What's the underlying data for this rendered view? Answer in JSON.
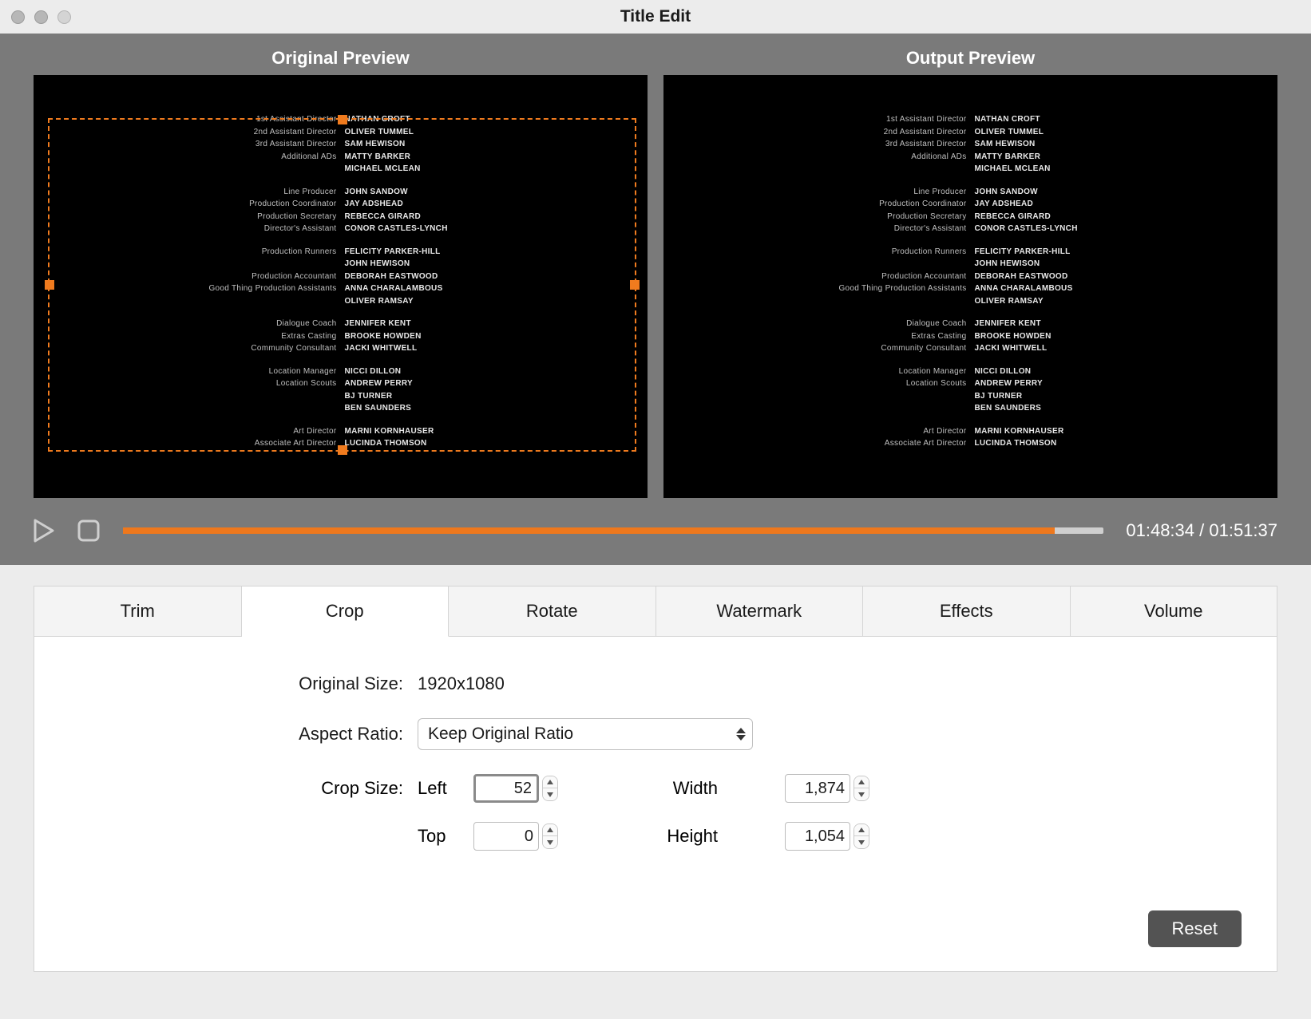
{
  "window": {
    "title": "Title Edit"
  },
  "preview": {
    "original_label": "Original Preview",
    "output_label": "Output  Preview",
    "credits": [
      {
        "role": "1st Assistant Director",
        "name": "NATHAN CROFT"
      },
      {
        "role": "2nd Assistant Director",
        "name": "OLIVER TUMMEL"
      },
      {
        "role": "3rd Assistant Director",
        "name": "SAM HEWISON"
      },
      {
        "role": "Additional ADs",
        "name": "MATTY BARKER"
      },
      {
        "role": "",
        "name": "MICHAEL MCLEAN"
      },
      {
        "role": "",
        "name": ""
      },
      {
        "role": "Line Producer",
        "name": "JOHN SANDOW"
      },
      {
        "role": "Production Coordinator",
        "name": "JAY ADSHEAD"
      },
      {
        "role": "Production Secretary",
        "name": "REBECCA GIRARD"
      },
      {
        "role": "Director's Assistant",
        "name": "CONOR CASTLES-LYNCH"
      },
      {
        "role": "",
        "name": ""
      },
      {
        "role": "Production Runners",
        "name": "FELICITY PARKER-HILL"
      },
      {
        "role": "",
        "name": "JOHN HEWISON"
      },
      {
        "role": "Production Accountant",
        "name": "DEBORAH EASTWOOD"
      },
      {
        "role": "Good Thing Production Assistants",
        "name": "ANNA CHARALAMBOUS"
      },
      {
        "role": "",
        "name": "OLIVER RAMSAY"
      },
      {
        "role": "",
        "name": ""
      },
      {
        "role": "Dialogue Coach",
        "name": "JENNIFER KENT"
      },
      {
        "role": "Extras Casting",
        "name": "BROOKE HOWDEN"
      },
      {
        "role": "Community Consultant",
        "name": "JACKI WHITWELL"
      },
      {
        "role": "",
        "name": ""
      },
      {
        "role": "Location Manager",
        "name": "NICCI DILLON"
      },
      {
        "role": "Location Scouts",
        "name": "ANDREW PERRY"
      },
      {
        "role": "",
        "name": "BJ TURNER"
      },
      {
        "role": "",
        "name": "BEN SAUNDERS"
      },
      {
        "role": "",
        "name": ""
      },
      {
        "role": "Art Director",
        "name": "MARNI KORNHAUSER"
      },
      {
        "role": "Associate Art Director",
        "name": "LUCINDA THOMSON"
      }
    ]
  },
  "transport": {
    "current": "01:48:34",
    "separator": " / ",
    "total": "01:51:37",
    "progress_percent": 95
  },
  "tabs": [
    {
      "id": "trim",
      "label": "Trim"
    },
    {
      "id": "crop",
      "label": "Crop"
    },
    {
      "id": "rotate",
      "label": "Rotate"
    },
    {
      "id": "watermark",
      "label": "Watermark"
    },
    {
      "id": "effects",
      "label": "Effects"
    },
    {
      "id": "volume",
      "label": "Volume"
    }
  ],
  "active_tab": "crop",
  "crop_panel": {
    "labels": {
      "original_size": "Original Size:",
      "aspect_ratio": "Aspect Ratio:",
      "crop_size": "Crop Size:",
      "left": "Left",
      "top": "Top",
      "width": "Width",
      "height": "Height",
      "reset": "Reset"
    },
    "values": {
      "original_size": "1920x1080",
      "aspect_ratio": "Keep Original Ratio",
      "left": "52",
      "top": "0",
      "width": "1,874",
      "height": "1,054"
    }
  },
  "colors": {
    "accent": "#ee781d",
    "crop_border": "#f07b1e"
  }
}
